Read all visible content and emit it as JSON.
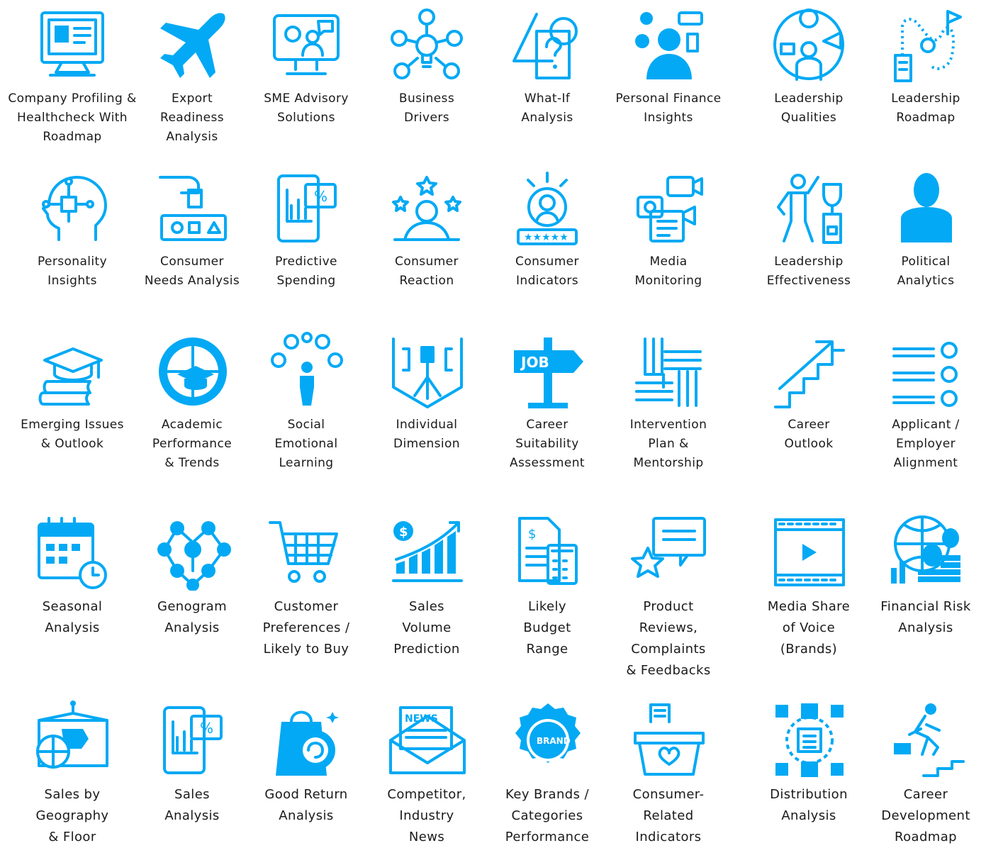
{
  "accent_color": "#03A9F4",
  "items": [
    {
      "icon": "computer-dashboard-icon",
      "label": "Company Profiling &\nHealthcheck With\nRoadmap"
    },
    {
      "icon": "airplane-icon",
      "label": "Export\nReadiness\nAnalysis"
    },
    {
      "icon": "video-consult-icon",
      "label": "SME Advisory\nSolutions"
    },
    {
      "icon": "lightbulb-network-icon",
      "label": "Business\nDrivers"
    },
    {
      "icon": "shapes-question-icon",
      "label": "What-If\nAnalysis"
    },
    {
      "icon": "person-money-icon",
      "label": "Personal Finance\nInsights"
    },
    {
      "icon": "leader-globe-icon",
      "label": "Leadership\nQualities"
    },
    {
      "icon": "roadmap-path-icon",
      "label": "Leadership\nRoadmap"
    },
    {
      "icon": "head-circuit-icon",
      "label": "Personality\nInsights"
    },
    {
      "icon": "hand-shape-sorter-icon",
      "label": "Consumer\nNeeds Analysis"
    },
    {
      "icon": "tablet-percent-chart-icon",
      "label": "Predictive\nSpending"
    },
    {
      "icon": "person-stars-icon",
      "label": "Consumer\nReaction"
    },
    {
      "icon": "person-rating-icon",
      "label": "Consumer\nIndicators"
    },
    {
      "icon": "media-devices-icon",
      "label": "Media\nMonitoring"
    },
    {
      "icon": "leader-trophy-icon",
      "label": "Leadership\nEffectiveness"
    },
    {
      "icon": "person-podium-icon",
      "label": "Political\nAnalytics"
    },
    {
      "icon": "books-graduation-icon",
      "label": "Emerging Issues\n& Outlook"
    },
    {
      "icon": "globe-graduation-icon",
      "label": "Academic\nPerformance\n& Trends"
    },
    {
      "icon": "person-emotions-icon",
      "label": "Social\nEmotional\nLearning"
    },
    {
      "icon": "individual-shield-icon",
      "label": "Individual\nDimension"
    },
    {
      "icon": "job-sign-icon",
      "label": "Career\nSuitability\nAssessment"
    },
    {
      "icon": "hands-teamwork-icon",
      "label": "Intervention\nPlan &\nMentorship"
    },
    {
      "icon": "stairs-arrow-icon",
      "label": "Career\nOutlook"
    },
    {
      "icon": "checklist-icon",
      "label": "Applicant /\nEmployer\nAlignment"
    },
    {
      "icon": "calendar-clock-icon",
      "label": "Seasonal\nAnalysis"
    },
    {
      "icon": "network-nodes-icon",
      "label": "Genogram\nAnalysis"
    },
    {
      "icon": "shopping-cart-icon",
      "label": "Customer\nPreferences /\nLikely to Buy"
    },
    {
      "icon": "sales-growth-icon",
      "label": "Sales\nVolume\nPrediction"
    },
    {
      "icon": "budget-calculator-icon",
      "label": "Likely\nBudget\nRange"
    },
    {
      "icon": "review-star-icon",
      "label": "Product\nReviews,\nComplaints\n& Feedbacks"
    },
    {
      "icon": "video-play-icon",
      "label": "Media Share\nof Voice\n(Brands)"
    },
    {
      "icon": "globe-coins-icon",
      "label": "Financial Risk\nAnalysis"
    },
    {
      "icon": "map-globe-icon",
      "label": "Sales by\nGeography\n& Floor"
    },
    {
      "icon": "tablet-percent-chart-icon",
      "label": "Sales\nAnalysis"
    },
    {
      "icon": "shopping-bag-return-icon",
      "label": "Good Return\nAnalysis"
    },
    {
      "icon": "news-envelope-icon",
      "label": "Competitor,\nIndustry\nNews"
    },
    {
      "icon": "brand-badge-icon",
      "label": "Key Brands /\nCategories\nPerformance"
    },
    {
      "icon": "basket-heart-icon",
      "label": "Consumer-\nRelated\nIndicators"
    },
    {
      "icon": "distribution-boxes-icon",
      "label": "Distribution\nAnalysis"
    },
    {
      "icon": "runner-stairs-icon",
      "label": "Career\nDevelopment\nRoadmap"
    }
  ]
}
